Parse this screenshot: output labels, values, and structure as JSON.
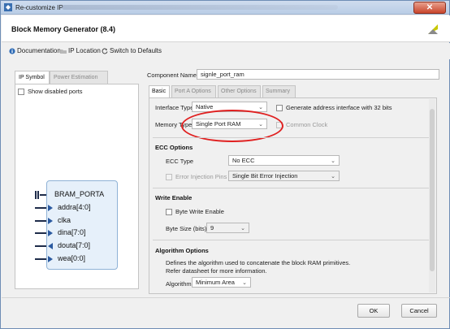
{
  "window": {
    "title": "Re-customize IP"
  },
  "header": {
    "title": "Block Memory Generator (8.4)"
  },
  "toolbar": {
    "documentation": "Documentation",
    "ip_location": "IP Location",
    "switch_defaults": "Switch to Defaults"
  },
  "left": {
    "tabs": [
      "IP Symbol",
      "Power Estimation"
    ],
    "show_disabled_ports": "Show disabled ports",
    "symbol": {
      "interface": "BRAM_PORTA",
      "ports": [
        {
          "name": "addra[4:0]",
          "dir": "in"
        },
        {
          "name": "clka",
          "dir": "in"
        },
        {
          "name": "dina[7:0]",
          "dir": "in"
        },
        {
          "name": "douta[7:0]",
          "dir": "out"
        },
        {
          "name": "wea[0:0]",
          "dir": "in"
        }
      ]
    }
  },
  "component": {
    "label": "Component Name",
    "value": "signle_port_ram"
  },
  "right": {
    "tabs": [
      "Basic",
      "Port A Options",
      "Other Options",
      "Summary"
    ],
    "interface_type": {
      "label": "Interface Type",
      "value": "Native"
    },
    "gen_address": "Generate address interface with 32 bits",
    "memory_type": {
      "label": "Memory Type",
      "value": "Single Port RAM"
    },
    "common_clock": "Common Clock",
    "ecc_section": "ECC Options",
    "ecc_type": {
      "label": "ECC Type",
      "value": "No ECC"
    },
    "error_injection": {
      "label": "Error Injection Pins",
      "value": "Single Bit Error Injection"
    },
    "write_enable_section": "Write Enable",
    "byte_write_enable": "Byte Write Enable",
    "byte_size": {
      "label": "Byte Size (bits)",
      "value": "9"
    },
    "algorithm_section": "Algorithm Options",
    "algorithm_desc_1": "Defines the algorithm used to concatenate the block RAM primitives.",
    "algorithm_desc_2": "Refer datasheet for more information.",
    "algorithm": {
      "label": "Algorithm",
      "value": "Minimum Area"
    }
  },
  "footer": {
    "ok": "OK",
    "cancel": "Cancel"
  },
  "colors": {
    "highlight": "#e02020",
    "symbol_fill": "#e6f0fa",
    "arrow": "#2b5aa0"
  }
}
